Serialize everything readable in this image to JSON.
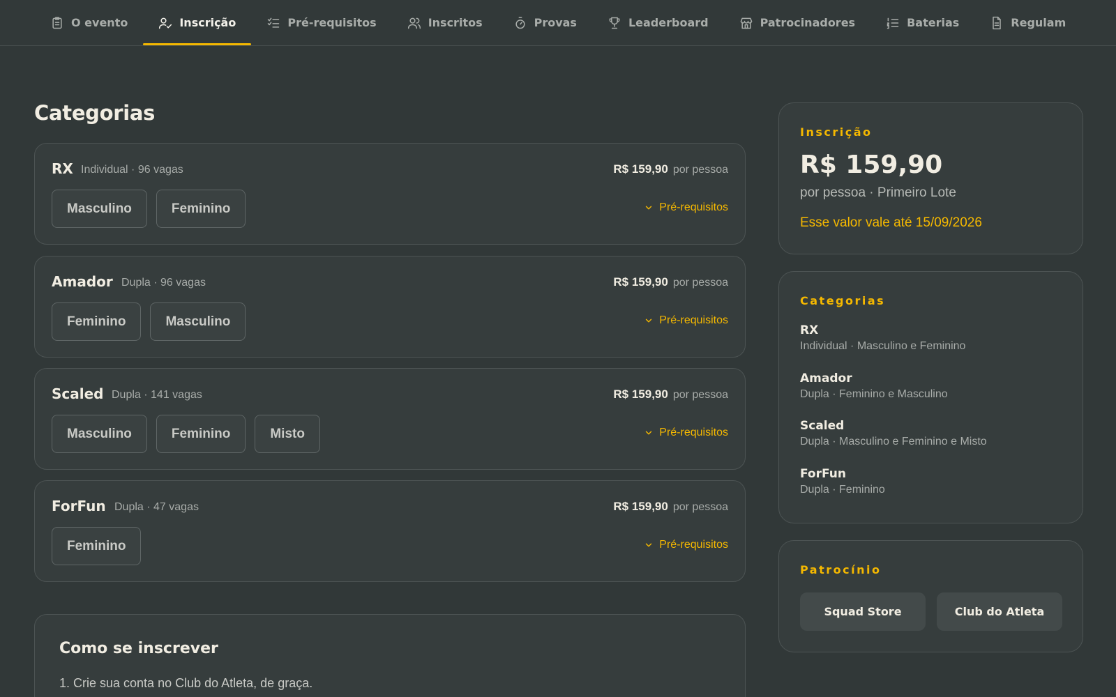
{
  "nav": {
    "tabs": [
      {
        "label": "O evento",
        "icon": "clipboard-icon"
      },
      {
        "label": "Inscrição",
        "icon": "user-check-icon",
        "active": true
      },
      {
        "label": "Pré-requisitos",
        "icon": "checklist-icon"
      },
      {
        "label": "Inscritos",
        "icon": "users-icon"
      },
      {
        "label": "Provas",
        "icon": "stopwatch-icon"
      },
      {
        "label": "Leaderboard",
        "icon": "trophy-icon"
      },
      {
        "label": "Patrocinadores",
        "icon": "store-icon"
      },
      {
        "label": "Baterias",
        "icon": "list-ordered-icon"
      },
      {
        "label": "Regulam",
        "icon": "document-icon"
      }
    ],
    "active_color": "#f5b800"
  },
  "main": {
    "title": "Categorias",
    "categories": [
      {
        "name": "RX",
        "meta": "Individual · 96 vagas",
        "price": "R$ 159,90",
        "per": "por pessoa",
        "options": [
          "Masculino",
          "Feminino"
        ],
        "prereq": "Pré-requisitos"
      },
      {
        "name": "Amador",
        "meta": "Dupla · 96 vagas",
        "price": "R$ 159,90",
        "per": "por pessoa",
        "options": [
          "Feminino",
          "Masculino"
        ],
        "prereq": "Pré-requisitos"
      },
      {
        "name": "Scaled",
        "meta": "Dupla · 141 vagas",
        "price": "R$ 159,90",
        "per": "por pessoa",
        "options": [
          "Masculino",
          "Feminino",
          "Misto"
        ],
        "prereq": "Pré-requisitos"
      },
      {
        "name": "ForFun",
        "meta": "Dupla · 47 vagas",
        "price": "R$ 159,90",
        "per": "por pessoa",
        "options": [
          "Feminino"
        ],
        "prereq": "Pré-requisitos"
      }
    ],
    "howto": {
      "title": "Como se inscrever",
      "step1": "1. Crie sua conta no Club do Atleta, de graça."
    }
  },
  "sidebar": {
    "registration": {
      "label": "Inscrição",
      "price": "R$ 159,90",
      "sub": "por pessoa · Primeiro Lote",
      "valid": "Esse valor vale até 15/09/2026"
    },
    "categories": {
      "label": "Categorias",
      "items": [
        {
          "name": "RX",
          "desc": "Individual · Masculino e Feminino"
        },
        {
          "name": "Amador",
          "desc": "Dupla · Feminino e Masculino"
        },
        {
          "name": "Scaled",
          "desc": "Dupla · Masculino e Feminino e Misto"
        },
        {
          "name": "ForFun",
          "desc": "Dupla · Feminino"
        }
      ]
    },
    "sponsorship": {
      "label": "Patrocínio",
      "sponsors": [
        "Squad Store",
        "Club do Atleta"
      ]
    }
  },
  "colors": {
    "accent": "#f5b800",
    "background": "#313838",
    "card": "#363d3d"
  }
}
